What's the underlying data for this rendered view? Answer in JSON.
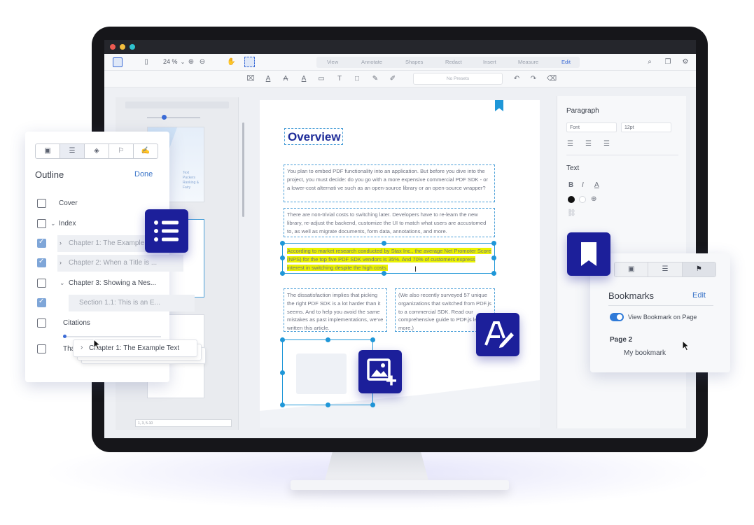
{
  "toolbar": {
    "zoom": "24 %",
    "tabs": [
      "View",
      "Annotate",
      "Shapes",
      "Redact",
      "Insert",
      "Measure",
      "Edit"
    ],
    "active_tab": "Edit",
    "preset_placeholder": "No Presets"
  },
  "document": {
    "heading": "Overview",
    "para1": "You plan to embed PDF functionality into an application. But before you dive into the project, you must decide: do you go with a more expensive commercial PDF SDK - or a lower-cost alternati ve such as an open-source library or an open-source wrapper?",
    "para2": "There are non-trivial costs to switching later. Developers have to re-learn the new library, re-adjust the backend, customize the UI to match what users are accustomed to, as well as migrate documents, form data, annotations, and more.",
    "para3": "According to market research conducted by Stax Inc., the average Net Promoter Score (NPS) for the top five PDF SDK vendors is 35%. And 70% of customers express interest in switching despite the high costs.",
    "para4": "The dissatisfaction implies that picking the right PDF SDK is a lot harder than it seems. And to help you avoid the same mistakes as past implementations, we've written this article.",
    "para5": "(We also recently surveyed 57 unique organizations that switched from PDF.js to a commercial SDK. Read our comprehensive guide to PDF.js learn more.)"
  },
  "right_panel": {
    "paragraph_label": "Paragraph",
    "font_select": "Font",
    "size_select": "12pt",
    "text_label": "Text"
  },
  "thumbnails": {
    "thumb_text": "Text Packers Ranking & Fairy",
    "page_range": "1, 3, 5-10"
  },
  "outline": {
    "title": "Outline",
    "done": "Done",
    "items": [
      {
        "label": "Cover"
      },
      {
        "label": "Index"
      },
      {
        "label": "Chapter 1: The Example"
      },
      {
        "label": "Chapter 2: When a Title is ..."
      },
      {
        "label": "Chapter 3: Showing a Nes..."
      },
      {
        "label": "Section 1.1: This is an E..."
      },
      {
        "label": "Citations"
      },
      {
        "label": "Tha"
      }
    ],
    "drag_label": "Chapter 1: The Example Text"
  },
  "bookmarks": {
    "title": "Bookmarks",
    "edit": "Edit",
    "toggle_label": "View Bookmark on Page",
    "page_label": "Page 2",
    "item": "My bookmark"
  },
  "colors": {
    "brand": "#1c1f9a",
    "selection": "#1f97d8",
    "highlight": "#eaf200",
    "heading": "#1e2c99"
  }
}
